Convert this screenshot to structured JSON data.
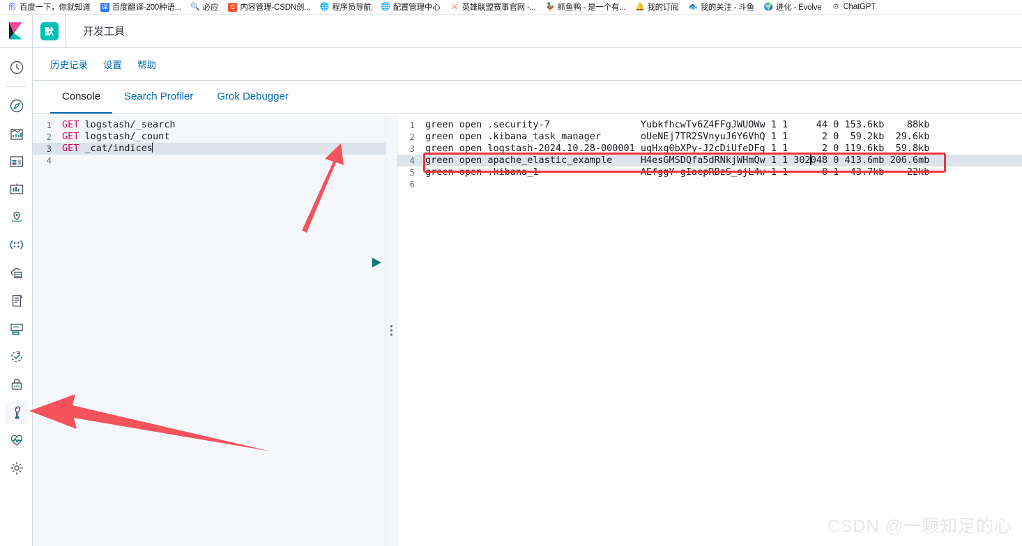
{
  "browser": {
    "bookmarks": [
      {
        "label": "百度一下，你就知道",
        "icon": "baidu-icon",
        "color": "#4c6ef5"
      },
      {
        "label": "百度翻译-200种语...",
        "icon": "translate-icon",
        "color": "#2979ff"
      },
      {
        "label": "必应",
        "icon": "search-icon",
        "color": "#3a3a3a"
      },
      {
        "label": "内容管理-CSDN创...",
        "icon": "csdn-icon",
        "color": "#fc5531"
      },
      {
        "label": "程序员导航",
        "icon": "globe-icon",
        "color": "#555f6b"
      },
      {
        "label": "配置管理中心",
        "icon": "globe-icon",
        "color": "#555f6b"
      },
      {
        "label": "英雄联盟赛事官网 -...",
        "icon": "lol-icon",
        "color": "#e8453c"
      },
      {
        "label": "抓鱼鸭 - 是一个有...",
        "icon": "duck-icon",
        "color": "#9aa2ad"
      },
      {
        "label": "我的订阅",
        "icon": "rss-icon",
        "color": "#f0a500"
      },
      {
        "label": "我的关注 - 斗鱼",
        "icon": "douyu-icon",
        "color": "#8f98a3"
      },
      {
        "label": "进化 - Evolve",
        "icon": "evolve-icon",
        "color": "#1a1a1a"
      },
      {
        "label": "ChatGPT",
        "icon": "chatgpt-icon",
        "color": "#6e6e80"
      }
    ]
  },
  "header": {
    "logo_name": "kibana-logo",
    "space_badge": "默",
    "app_title": "开发工具"
  },
  "sidebar": {
    "items": [
      {
        "name": "recently-viewed",
        "icon": "clock-icon"
      },
      {
        "name": "discover",
        "icon": "compass-icon"
      },
      {
        "name": "visualize",
        "icon": "bar-chart-icon"
      },
      {
        "name": "dashboard",
        "icon": "dashboard-icon"
      },
      {
        "name": "canvas",
        "icon": "canvas-icon"
      },
      {
        "name": "maps",
        "icon": "map-pin-icon"
      },
      {
        "name": "machine-learning",
        "icon": "machine-learning-icon"
      },
      {
        "name": "infrastructure",
        "icon": "infrastructure-icon"
      },
      {
        "name": "logs",
        "icon": "logs-icon"
      },
      {
        "name": "apm",
        "icon": "apm-icon"
      },
      {
        "name": "uptime",
        "icon": "uptime-icon"
      },
      {
        "name": "security",
        "icon": "lock-icon"
      },
      {
        "name": "dev-tools",
        "icon": "wrench-icon",
        "active": true
      },
      {
        "name": "monitoring",
        "icon": "heartbeat-icon"
      },
      {
        "name": "management",
        "icon": "gear-icon"
      }
    ]
  },
  "subnav": {
    "links": [
      {
        "label": "历史记录"
      },
      {
        "label": "设置"
      },
      {
        "label": "帮助"
      }
    ]
  },
  "tabs": [
    {
      "label": "Console",
      "active": true
    },
    {
      "label": "Search Profiler",
      "active": false
    },
    {
      "label": "Grok Debugger",
      "active": false
    }
  ],
  "editor": {
    "run_button": "play-icon",
    "wrench_button": "wrench-icon",
    "lines": [
      {
        "num": "1",
        "method": "GET",
        "path": " logstash/_search",
        "current": false
      },
      {
        "num": "2",
        "method": "GET",
        "path": " logstash/_count",
        "current": false
      },
      {
        "num": "3",
        "method": "GET",
        "path": " _cat/indices",
        "current": true
      },
      {
        "num": "4",
        "method": "",
        "path": "",
        "current": false
      }
    ]
  },
  "response": {
    "lines": [
      {
        "num": "1",
        "text": "green open .security-7                YubkfhcwTv6Z4FFgJWUOWw 1 1     44 0 153.6kb    88kb",
        "highlight": false
      },
      {
        "num": "2",
        "text": "green open .kibana_task_manager       oUeNEj7TR2SVnyuJ6Y6VhQ 1 1      2 0  59.2kb  29.6kb",
        "highlight": false
      },
      {
        "num": "3",
        "text": "green open logstash-2024.10.28-000001 uqHxg0bXPy-J2cDiUfeDFg 1 1      2 0 119.6kb  59.8kb",
        "highlight": false
      },
      {
        "num": "4",
        "text": "green open apache_elastic_example     H4esGMSDQfa5dRNkjWHmQw 1 1 302048 0 413.6mb 206.6mb",
        "highlight": true
      },
      {
        "num": "5",
        "text": "green open .kibana_1                  AEfggY-gIaepRBzS_sjL4w 1 1      8 1  43.7kb    22kb",
        "highlight": false
      },
      {
        "num": "6",
        "text": "",
        "highlight": false
      }
    ]
  },
  "annotations": {
    "arrow_to_play": "red-arrow-up-right",
    "arrow_to_devtools": "red-arrow-left",
    "highlight_box": "red-highlight-box",
    "color": "#f4535c"
  },
  "watermark": "CSDN @一颗知足的心"
}
